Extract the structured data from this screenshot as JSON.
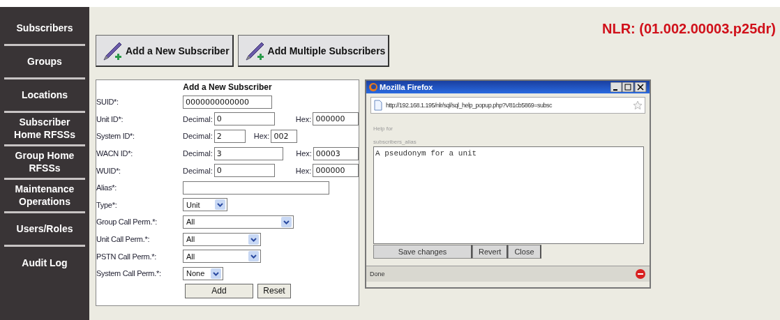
{
  "sidebar": {
    "items": [
      {
        "label": "Subscribers"
      },
      {
        "label": "Groups"
      },
      {
        "label": "Locations"
      },
      {
        "label": "Subscriber Home RFSSs"
      },
      {
        "label": "Group Home RFSSs"
      },
      {
        "label": "Maintenance Operations"
      },
      {
        "label": "Users/Roles"
      },
      {
        "label": "Audit Log"
      }
    ]
  },
  "header": {
    "title": "NLR: (01.002.00003.p25dr)"
  },
  "toolbar": {
    "buttons": [
      {
        "label": "Add a New Subscriber"
      },
      {
        "label": "Add Multiple Subscribers"
      }
    ]
  },
  "form": {
    "title": "Add a New Subscriber",
    "fields": [
      {
        "kind": "text",
        "label": "SUID*:",
        "value": "0000000000000"
      },
      {
        "kind": "dec_hex",
        "label": "Unit ID*:",
        "decimal_label": "Decimal:",
        "decimal": "0",
        "hex_label": "Hex:",
        "hex": "000000"
      },
      {
        "kind": "dec_hex",
        "label": "System ID*:",
        "decimal_label": "Decimal:",
        "decimal": "2",
        "hex_label": "Hex:",
        "hex": "002"
      },
      {
        "kind": "dec_hex",
        "label": "WACN ID*:",
        "decimal_label": "Decimal:",
        "decimal": "3",
        "hex_label": "Hex:",
        "hex": "00003"
      },
      {
        "kind": "dec_hex",
        "label": "WUID*:",
        "decimal_label": "Decimal:",
        "decimal": "0",
        "hex_label": "Hex:",
        "hex": "000000"
      },
      {
        "kind": "text",
        "label": "Alias*:"
      },
      {
        "kind": "select",
        "label": "Type*:",
        "value": "Unit"
      },
      {
        "kind": "select",
        "label": "Group Call Perm.*:",
        "value": "All"
      },
      {
        "kind": "select",
        "label": "Unit Call Perm.*:",
        "value": "All"
      },
      {
        "kind": "select",
        "label": "PSTN Call Perm.*:",
        "value": "All"
      },
      {
        "kind": "select",
        "label": "System Call Perm.*:",
        "value": "None"
      }
    ],
    "buttons": [
      {
        "label": "Add"
      },
      {
        "label": "Reset"
      }
    ]
  },
  "popup": {
    "title": "Mozilla Firefox",
    "url": "http://192.168.1.195/nlr/sql/sql_help_popup.php?V81cb5869=subsc",
    "help_label": "Help for",
    "help_key": "subscribers_alias",
    "text": "A pseudonym for a unit",
    "buttons": [
      {
        "label": "Save changes"
      },
      {
        "label": "Revert"
      },
      {
        "label": "Close"
      }
    ],
    "status": "Done"
  }
}
